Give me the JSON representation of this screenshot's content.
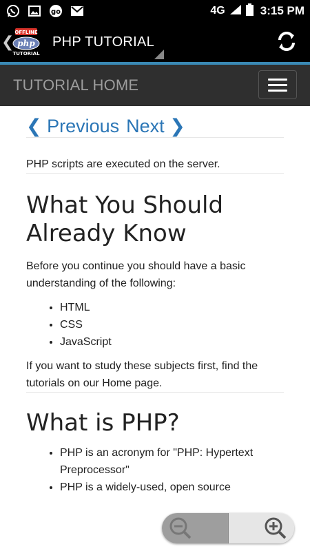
{
  "status_bar": {
    "icons_left": [
      "whatsapp-icon",
      "gallery-icon",
      "go-icon",
      "gmail-icon"
    ],
    "network": "4G",
    "time": "3:15 PM"
  },
  "action_bar": {
    "logo_badge": "OFFLINE",
    "logo_word": "php",
    "logo_sub": "TUTORIAL",
    "title": "PHP TUTORIAL"
  },
  "tutorial_bar": {
    "title": "TUTORIAL HOME"
  },
  "content": {
    "prev_label": "❮ Previous",
    "next_label": "Next ❯",
    "intro": "PHP scripts are executed on the server.",
    "section1_heading": "What You Should Already Know",
    "section1_body": "Before you continue you should have a basic understanding of the following:",
    "section1_list": [
      "HTML",
      "CSS",
      "JavaScript"
    ],
    "section1_footer": "If you want to study these subjects first, find the tutorials on our Home page.",
    "section2_heading": "What is PHP?",
    "section2_list": [
      "PHP is an acronym for \"PHP: Hypertext Preprocessor\"",
      "PHP is a widely-used, open source"
    ]
  },
  "colors": {
    "link": "#2b76b6",
    "accent_line": "#3a89b5",
    "nav_bar": "#2f2f2f"
  }
}
